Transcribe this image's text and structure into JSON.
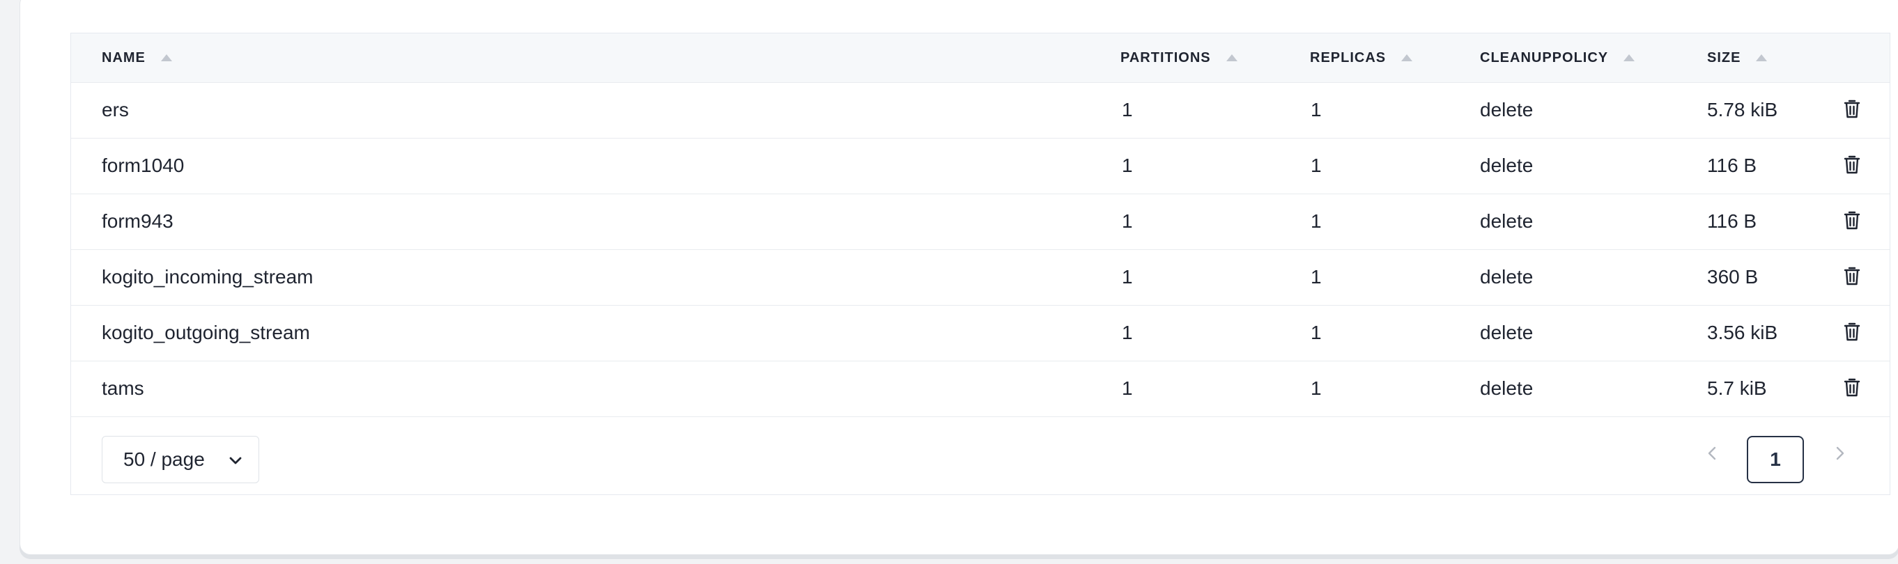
{
  "table": {
    "columns": [
      {
        "label": "NAME"
      },
      {
        "label": "PARTITIONS"
      },
      {
        "label": "REPLICAS"
      },
      {
        "label": "CLEANUPPOLICY"
      },
      {
        "label": "SIZE"
      }
    ],
    "rows": [
      {
        "name": "ers",
        "partitions": "1",
        "replicas": "1",
        "cleanup": "delete",
        "size": "5.78 kiB"
      },
      {
        "name": "form1040",
        "partitions": "1",
        "replicas": "1",
        "cleanup": "delete",
        "size": "116 B"
      },
      {
        "name": "form943",
        "partitions": "1",
        "replicas": "1",
        "cleanup": "delete",
        "size": "116 B"
      },
      {
        "name": "kogito_incoming_stream",
        "partitions": "1",
        "replicas": "1",
        "cleanup": "delete",
        "size": "360 B"
      },
      {
        "name": "kogito_outgoing_stream",
        "partitions": "1",
        "replicas": "1",
        "cleanup": "delete",
        "size": "3.56 kiB"
      },
      {
        "name": "tams",
        "partitions": "1",
        "replicas": "1",
        "cleanup": "delete",
        "size": "5.7 kiB"
      }
    ],
    "row_action_icon": "trash-icon"
  },
  "pagination": {
    "page_size_label": "50 / page",
    "current_page": "1",
    "prev_icon": "chevron-left-icon",
    "next_icon": "chevron-right-icon"
  },
  "colors": {
    "accent_red": "#e9432a",
    "header_bg": "#f6f8fa",
    "page_border": "#263145"
  }
}
